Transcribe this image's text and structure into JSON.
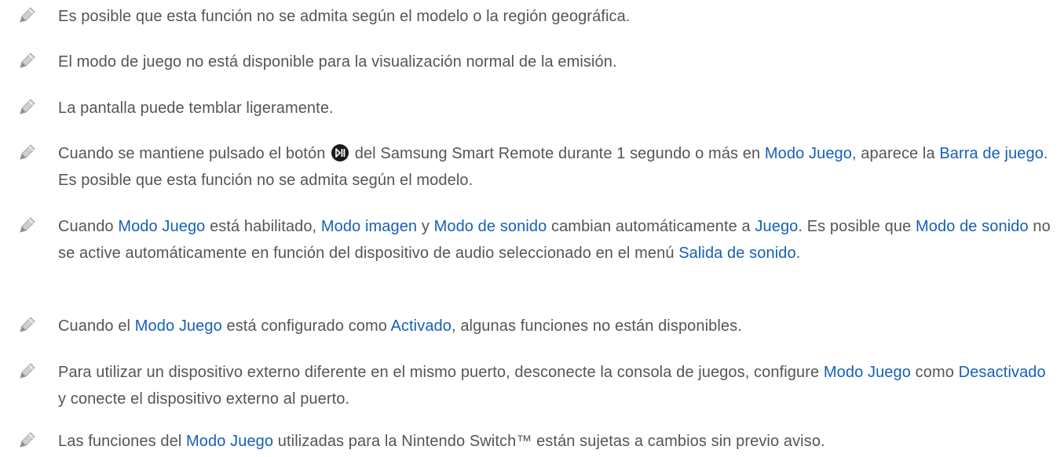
{
  "notes": [
    {
      "t0": "Es posible que esta función no se admita según el modelo o la región geográfica."
    },
    {
      "t0": "El modo de juego no está disponible para la visualización normal de la emisión."
    },
    {
      "t0": "La pantalla puede temblar ligeramente."
    },
    {
      "t0": "Cuando se mantiene pulsado el botón ",
      "t1": " del Samsung Smart Remote durante 1 segundo o más en ",
      "l1": "Modo Juego",
      "t2": ", aparece la ",
      "l2": "Barra de juego",
      "t3": ". Es posible que esta función no se admita según el modelo."
    },
    {
      "t0": "Cuando ",
      "l1": "Modo Juego",
      "t1": " está habilitado, ",
      "l2": "Modo imagen",
      "t2": " y ",
      "l3": "Modo de sonido",
      "t3": " cambian automáticamente a ",
      "l4": "Juego",
      "t4": ". Es posible que ",
      "l5": "Modo de sonido",
      "t5": " no se active automáticamente en función del dispositivo de audio seleccionado en el menú ",
      "l6": "Salida de sonido",
      "t6": "."
    },
    {
      "t0": "Cuando el ",
      "l1": "Modo Juego",
      "t1": " está configurado como ",
      "l2": "Activado",
      "t2": ", algunas funciones no están disponibles."
    },
    {
      "t0": "Para utilizar un dispositivo externo diferente en el mismo puerto, desconecte la consola de juegos, configure ",
      "l1": "Modo Juego",
      "t1": " como ",
      "l2": "Desactivado",
      "t2": " y conecte el dispositivo externo al puerto."
    },
    {
      "t0": "Las funciones del ",
      "l1": "Modo Juego",
      "t1": " utilizadas para la Nintendo Switch™ están sujetas a cambios sin previo aviso."
    }
  ],
  "icons": {
    "note": "pencil-note-icon",
    "remote_button": "play-pause-button-icon"
  },
  "colors": {
    "text": "#555555",
    "highlight": "#1560b8",
    "icon": "#bdbdbd"
  }
}
